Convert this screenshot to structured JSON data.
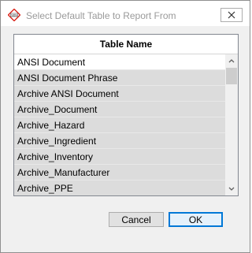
{
  "window": {
    "title": "Select Default Table to Report From",
    "icon": "sds-diamond-icon",
    "close_glyph": "✕"
  },
  "grid": {
    "column_header": "Table Name",
    "rows": [
      "ANSI Document",
      "ANSI Document Phrase",
      "Archive ANSI Document",
      "Archive_Document",
      "Archive_Hazard",
      "Archive_Ingredient",
      "Archive_Inventory",
      "Archive_Manufacturer",
      "Archive_PPE"
    ]
  },
  "buttons": {
    "cancel_label": "Cancel",
    "ok_label": "OK"
  },
  "colors": {
    "selected_row_shade": "#dcdcdc",
    "ok_border": "#0078d7"
  }
}
